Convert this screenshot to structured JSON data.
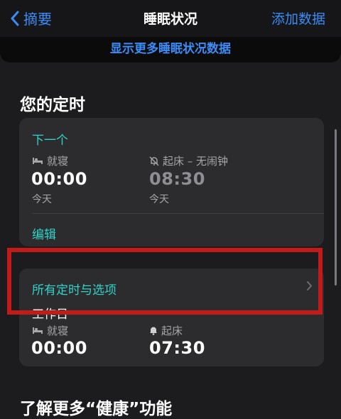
{
  "nav": {
    "back_label": "摘要",
    "title": "睡眠状况",
    "add_label": "添加数据"
  },
  "more_link": "显示更多睡眠状况数据",
  "schedule": {
    "section_title": "您的定时",
    "next": {
      "header": "下一个",
      "bedtime_label": "就寝",
      "bedtime_time": "00:00",
      "bedtime_day": "今天",
      "wake_label": "起床 – 无闹钟",
      "wake_time": "08:30",
      "wake_day": "今天",
      "edit_label": "编辑"
    },
    "all": {
      "header": "所有定时与选项",
      "days_label": "工作日",
      "bedtime_label": "就寝",
      "bedtime_time": "00:00",
      "wake_label": "起床",
      "wake_time": "07:30"
    }
  },
  "footer_title": "了解更多“健康”功能",
  "icons": {
    "back": "chevron-left-icon",
    "bed": "bed-icon",
    "alarm_off": "alarm-off-icon",
    "alarm": "bell-icon",
    "chevron": "chevron-right-icon"
  },
  "colors": {
    "accent_blue": "#3b8cf7",
    "accent_teal": "#2fd3c9",
    "highlight_red": "#c31a1a",
    "background": "#1c1c1e",
    "card": "#2c2c2e"
  }
}
